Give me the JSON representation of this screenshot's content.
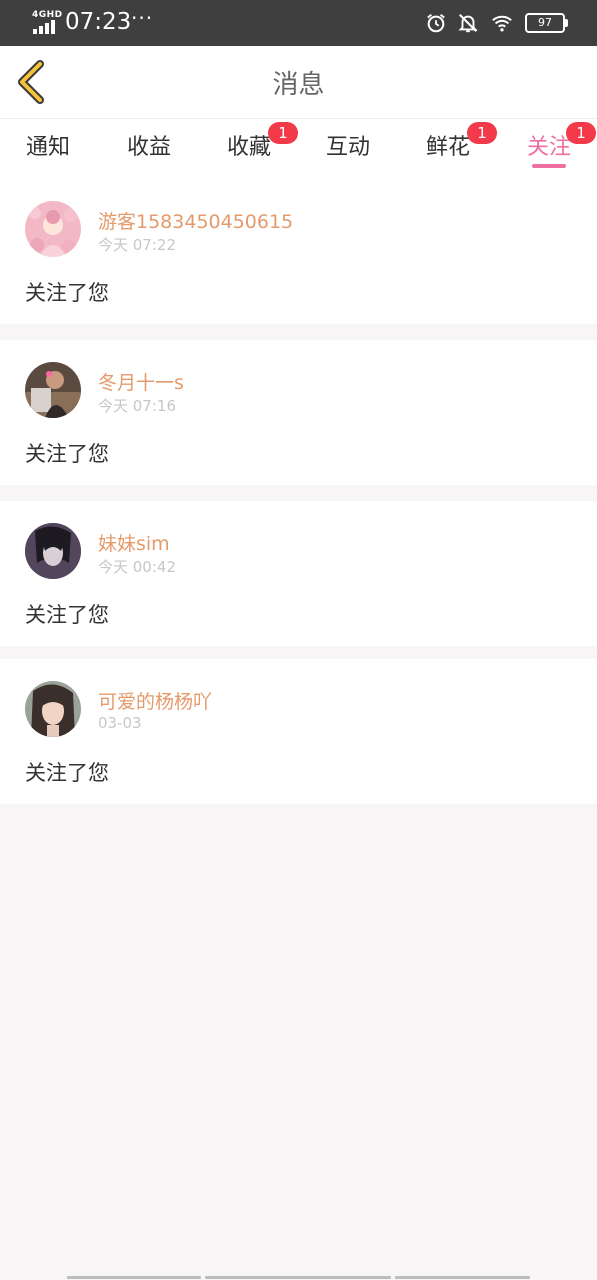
{
  "status_bar": {
    "network": "4GHD",
    "time": "07:23",
    "dots": "···",
    "battery": "97"
  },
  "header": {
    "title": "消息",
    "back_icon": "chevron-left-icon"
  },
  "tabs": [
    {
      "label": "通知",
      "badge": ""
    },
    {
      "label": "收益",
      "badge": ""
    },
    {
      "label": "收藏",
      "badge": "1"
    },
    {
      "label": "互动",
      "badge": ""
    },
    {
      "label": "鲜花",
      "badge": "1"
    },
    {
      "label": "关注",
      "badge": "1",
      "active": true
    }
  ],
  "messages": [
    {
      "name": "游客1583450450615",
      "time": "今天 07:22",
      "text": "关注了您"
    },
    {
      "name": "冬月十一s",
      "time": "今天 07:16",
      "text": "关注了您"
    },
    {
      "name": "妹妹sim",
      "time": "今天 00:42",
      "text": "关注了您"
    },
    {
      "name": "可爱的杨杨吖",
      "time": "03-03",
      "text": "关注了您"
    }
  ],
  "colors": {
    "accent": "#f06fa2",
    "name": "#e59a6b",
    "badge": "#f23a4a",
    "status_bar": "#3f3f3f",
    "page_bg": "#f7f5f5"
  }
}
